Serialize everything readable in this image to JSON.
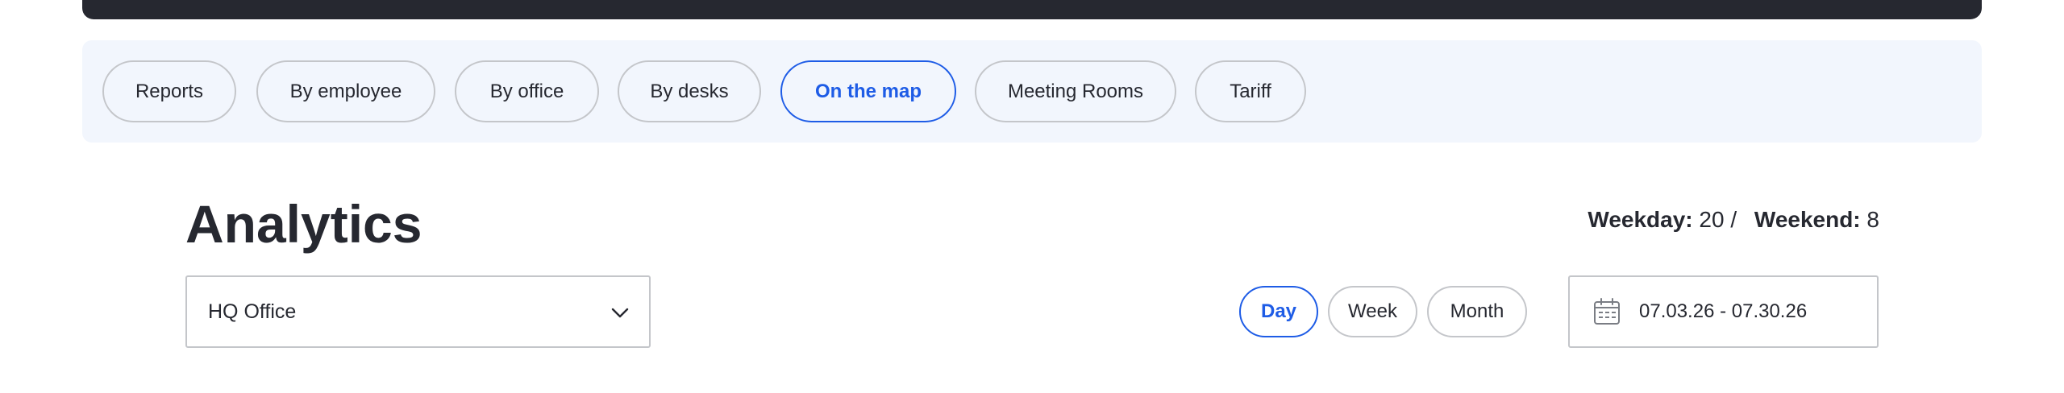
{
  "tabs": [
    {
      "label": "Reports",
      "active": false
    },
    {
      "label": "By employee",
      "active": false
    },
    {
      "label": "By office",
      "active": false
    },
    {
      "label": "By desks",
      "active": false
    },
    {
      "label": "On the map",
      "active": true
    },
    {
      "label": "Meeting Rooms",
      "active": false
    },
    {
      "label": "Tariff",
      "active": false
    }
  ],
  "header": {
    "title": "Analytics",
    "weekday_label": "Weekday:",
    "weekday_value": "20 /",
    "weekend_label": "Weekend:",
    "weekend_value": "8"
  },
  "filters": {
    "office_selected": "HQ Office",
    "periods": [
      {
        "label": "Day",
        "active": true
      },
      {
        "label": "Week",
        "active": false
      },
      {
        "label": "Month",
        "active": false
      }
    ],
    "date_range": "07.03.26 - 07.30.26"
  },
  "colors": {
    "accent": "#1e5ce6",
    "dark": "#262830",
    "strip_bg": "#f2f6fd",
    "border": "#c4c6ca"
  }
}
